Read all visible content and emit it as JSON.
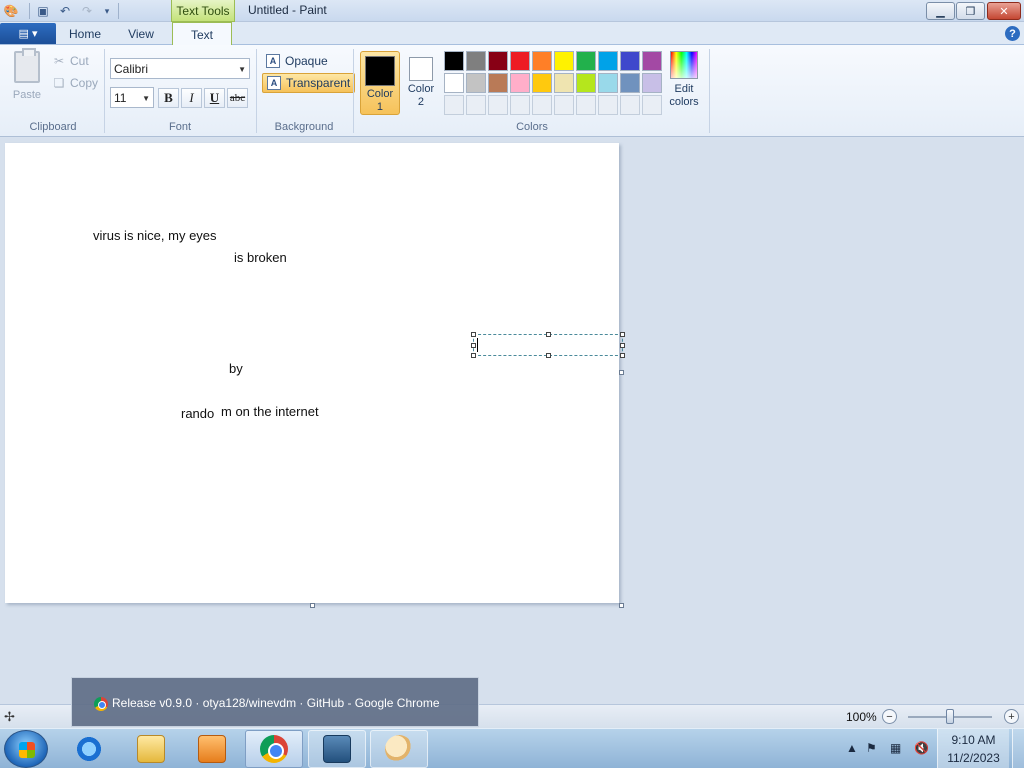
{
  "titlebar": {
    "context_tab": "Text Tools",
    "title": "Untitled - Paint",
    "minimize_icon": "minimize-icon",
    "maximize_icon": "restore-icon",
    "close_icon": "close-icon"
  },
  "tabs": {
    "file_menu_icon": "paint-menu-icon",
    "home": "Home",
    "view": "View",
    "text": "Text"
  },
  "clipboard": {
    "label": "Clipboard",
    "paste": "Paste",
    "cut": "Cut",
    "copy": "Copy"
  },
  "font": {
    "label": "Font",
    "family": "Calibri",
    "size": "11",
    "bold": "B",
    "italic": "I",
    "underline": "U",
    "strikethrough": "abc"
  },
  "background": {
    "label": "Background",
    "opaque": "Opaque",
    "transparent": "Transparent",
    "selected": "Transparent"
  },
  "colors": {
    "label": "Colors",
    "color1_label_a": "Color",
    "color1_label_b": "1",
    "color2_label_a": "Color",
    "color2_label_b": "2",
    "color1": "#000000",
    "color2": "#ffffff",
    "edit_a": "Edit",
    "edit_b": "colors",
    "palette": [
      "#000000",
      "#7f7f7f",
      "#880015",
      "#ed1c24",
      "#ff7f27",
      "#fff200",
      "#22b14c",
      "#00a2e8",
      "#3f48cc",
      "#a349a4",
      "#ffffff",
      "#c3c3c3",
      "#b97a57",
      "#ffaec9",
      "#ffc90e",
      "#efe4b0",
      "#b5e61d",
      "#99d9ea",
      "#7092be",
      "#c8bfe7"
    ]
  },
  "canvas": {
    "texts": [
      "virus is nice, my eyes",
      "is broken",
      "by",
      "rando",
      "m on the internet"
    ]
  },
  "statusbar": {
    "zoom": "100%",
    "zoom_out": "−",
    "zoom_in": "+"
  },
  "chrome_preview": {
    "title": "Release v0.9.0 · otya128/winevdm · GitHub - Google Chrome"
  },
  "taskbar": {
    "time": "9:10 AM",
    "date": "11/2/2023"
  }
}
